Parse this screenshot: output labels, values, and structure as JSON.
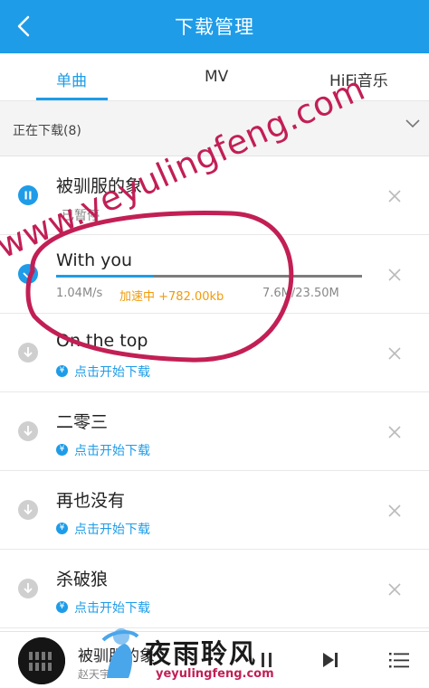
{
  "header": {
    "title": "下载管理"
  },
  "tabs": [
    {
      "label": "单曲",
      "active": true
    },
    {
      "label": "MV",
      "active": false
    },
    {
      "label": "HiFi音乐",
      "active": false
    }
  ],
  "section": {
    "label": "正在下载(8)"
  },
  "rows": [
    {
      "title": "被驯服的象",
      "status": "已暂停",
      "state": "paused"
    },
    {
      "title": "With you",
      "state": "downloading",
      "speed_left": "1.04M/s",
      "speed_boost": "加速中 +782.00kb",
      "size": "7.6M/23.50M",
      "progress": 0.32
    },
    {
      "title": "On the top",
      "status": "点击开始下载",
      "state": "waiting"
    },
    {
      "title": "二零三",
      "status": "点击开始下载",
      "state": "waiting"
    },
    {
      "title": "再也没有",
      "status": "点击开始下载",
      "state": "waiting"
    },
    {
      "title": "杀破狼",
      "status": "点击开始下载",
      "state": "waiting"
    }
  ],
  "player": {
    "title": "被驯服的象",
    "artist": "赵天宇"
  },
  "watermark": {
    "url": "www.yeyulingfeng.com",
    "brand": "夜雨聆风",
    "brand_url": "yeyulingfeng.com"
  },
  "colors": {
    "accent": "#1e9ce8",
    "boost": "#f29b0a",
    "watermark": "#c21f55"
  }
}
